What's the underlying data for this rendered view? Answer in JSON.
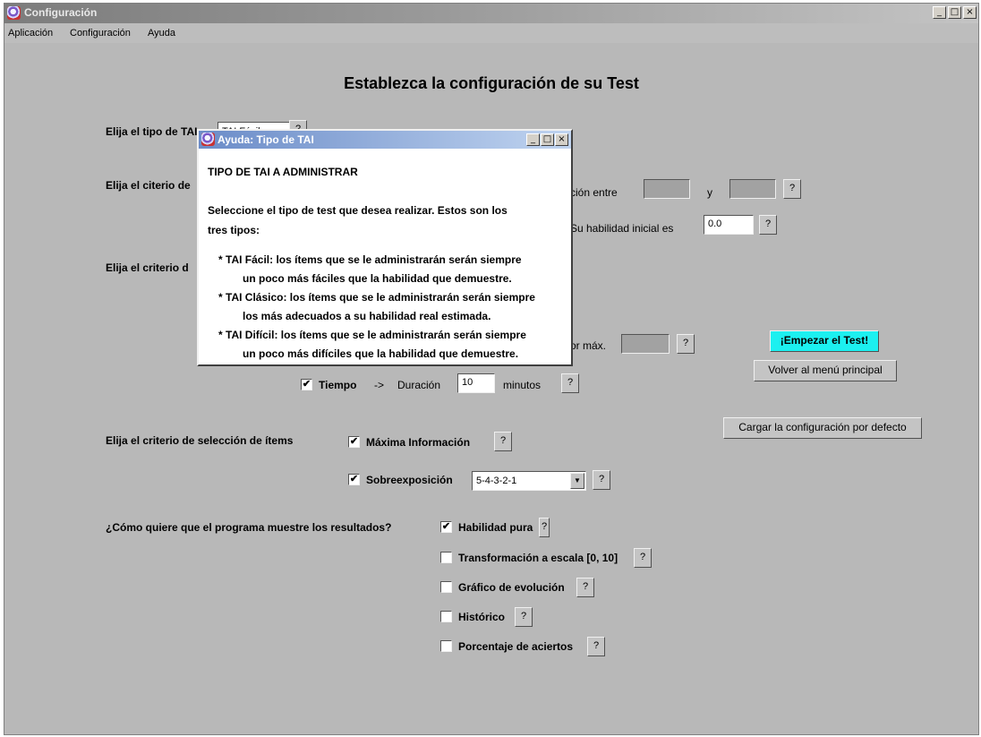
{
  "window": {
    "title": "Configuración",
    "controls": {
      "minimize": "_",
      "maximize": "□",
      "close": "×"
    }
  },
  "menu": [
    "Aplicación",
    "Configuración",
    "Ayuda"
  ],
  "heading": "Establezca la configuración de su Test",
  "tai_type": {
    "label": "Elija el tipo de TAI",
    "value": "TAI Fácil",
    "help": "?"
  },
  "estimation": {
    "label": "Elija el citerio de",
    "range_text": "ción entre",
    "and_text": "y",
    "min_value": "",
    "max_value": "",
    "help": "?",
    "initial_text": "Su habilidad inicial es",
    "initial_value": "0.0",
    "initial_help": "?"
  },
  "stop_criteria": {
    "label": "Elija el criterio d",
    "max_text": "or máx.",
    "max_value": "",
    "max_help": "?",
    "time": {
      "checked": true,
      "label": "Tiempo",
      "arrow": "->",
      "duration_label": "Duración",
      "value": "10",
      "units": "minutos",
      "help": "?"
    }
  },
  "buttons": {
    "start": "¡Empezar el Test!",
    "back": "Volver al menú principal",
    "defaults": "Cargar la configuración por defecto"
  },
  "selection": {
    "label": "Elija el criterio de selección de ítems",
    "max_info": {
      "checked": true,
      "label": "Máxima Información",
      "help": "?"
    },
    "overexposure": {
      "checked": true,
      "label": "Sobreexposición",
      "value": "5-4-3-2-1",
      "help": "?"
    }
  },
  "results": {
    "label": "¿Cómo quiere que el programa muestre los resultados?",
    "options": [
      {
        "checked": true,
        "label": "Habilidad pura",
        "help": "?"
      },
      {
        "checked": false,
        "label": "Transformación a escala [0, 10]",
        "help": "?"
      },
      {
        "checked": false,
        "label": "Gráfico de evolución",
        "help": "?"
      },
      {
        "checked": false,
        "label": "Histórico",
        "help": "?"
      },
      {
        "checked": false,
        "label": "Porcentaje de aciertos",
        "help": "?"
      }
    ]
  },
  "dialog": {
    "title": "Ayuda: Tipo de TAI",
    "heading": "TIPO DE TAI A ADMINISTRAR",
    "intro": [
      "Seleccione el tipo de test que desea realizar. Estos son los",
      "tres tipos:"
    ],
    "bullets": [
      "* TAI Fácil: los ítems que se le administrarán serán siempre",
      "un poco más fáciles que la habilidad que demuestre.",
      "* TAI Clásico: los ítems que se le administrarán serán siempre",
      "los más adecuados a su habilidad real estimada.",
      "* TAI Difícil: los ítems que se le administrarán serán siempre",
      "un poco más difíciles que la habilidad que demuestre."
    ]
  }
}
